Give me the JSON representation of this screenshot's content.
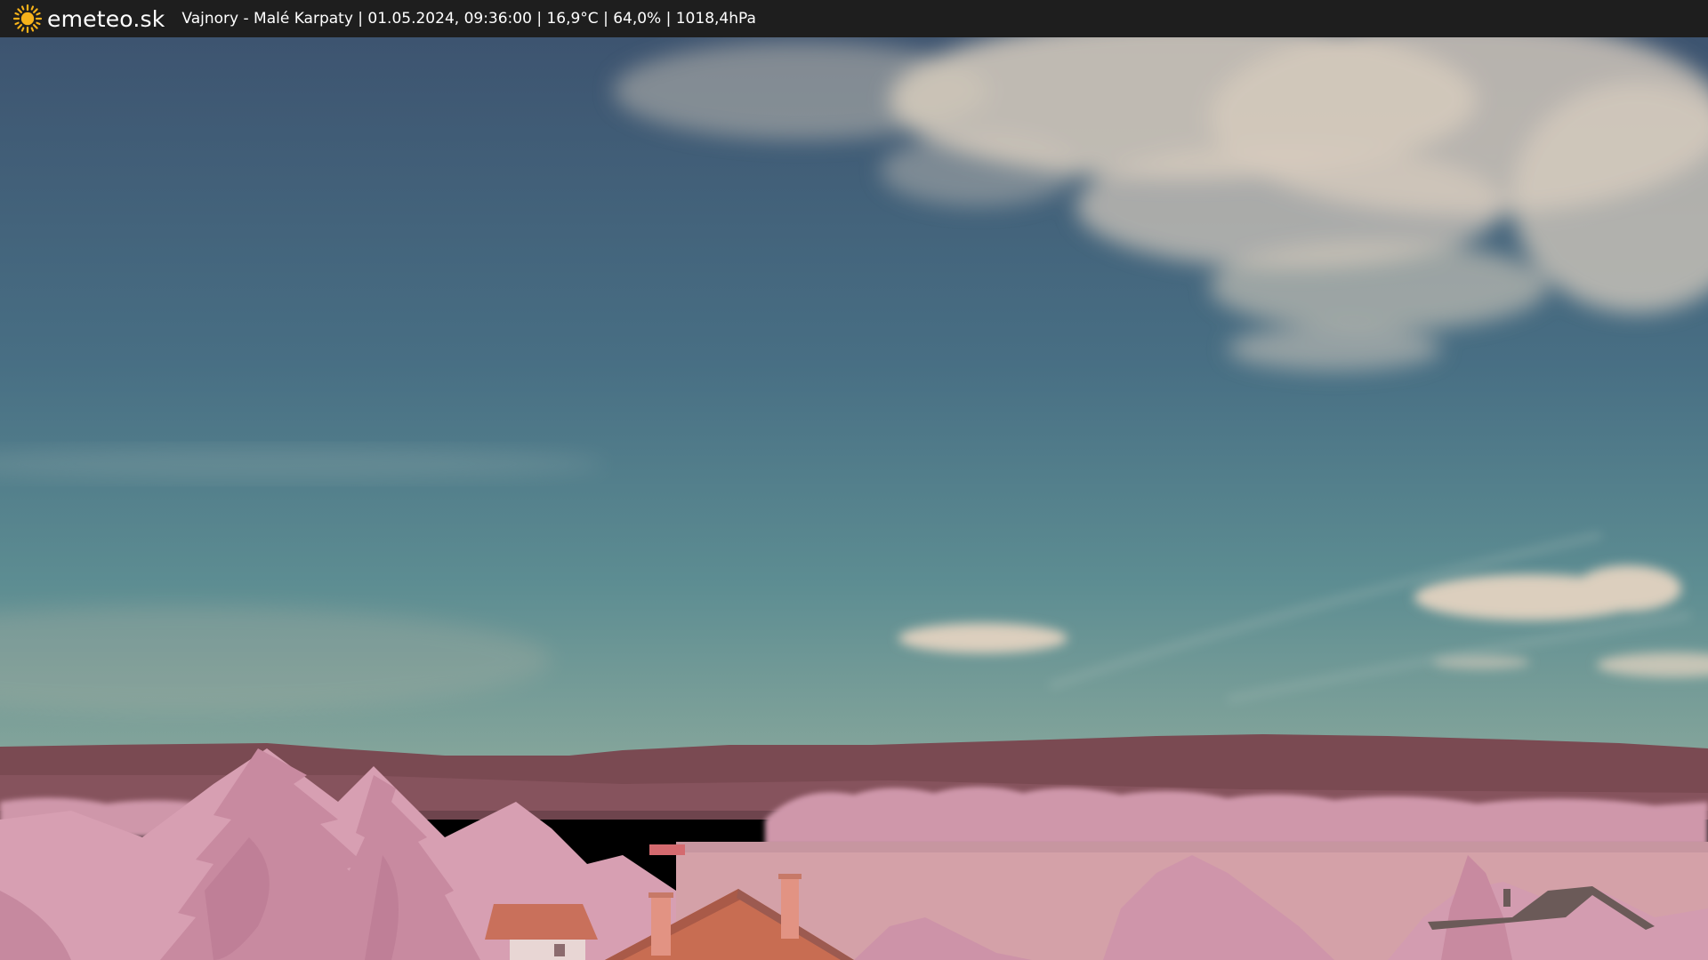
{
  "header": {
    "brand": "emeteo.sk",
    "caption": "Vajnory - Malé Karpaty | 01.05.2024, 09:36:00 | 16,9°C | 64,0% | 1018,4hPa",
    "logo_icon": "sun-icon",
    "logo_color": "#f6b21a",
    "bar_color": "#1e1e1e"
  },
  "scene": {
    "sky_top_color": "#3e5770",
    "sky_mid_color": "#4e7d8a",
    "sky_horizon_color": "#7f9e98",
    "cloud_color": "#d4c9bd",
    "hills_color": "#7c4a52",
    "foliage_color": "#d9a1b3",
    "field_color": "#d2a0a6",
    "roof_color": "#c96f55"
  }
}
